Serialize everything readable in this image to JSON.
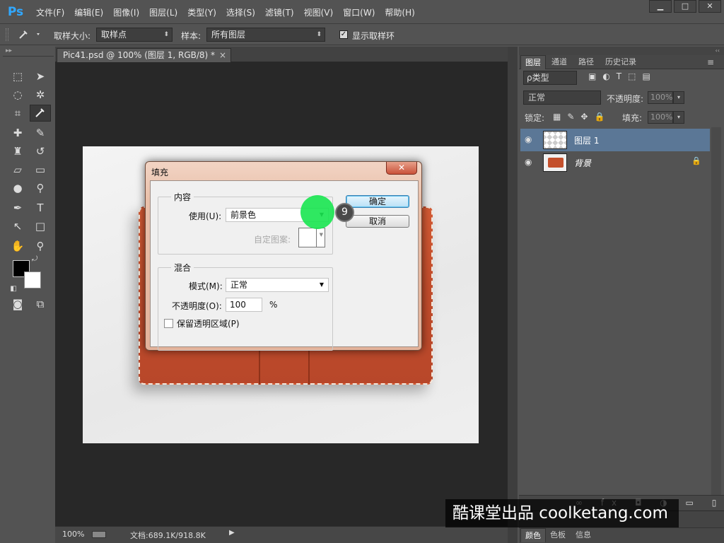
{
  "app": {
    "logo": "Ps",
    "menus": [
      "文件(F)",
      "编辑(E)",
      "图像(I)",
      "图层(L)",
      "类型(Y)",
      "选择(S)",
      "滤镜(T)",
      "视图(V)",
      "窗口(W)",
      "帮助(H)"
    ],
    "window_buttons": [
      "▁",
      "□",
      "✕"
    ]
  },
  "options_bar": {
    "sample_size_label": "取样大小:",
    "sample_size_value": "取样点",
    "sample_label": "样本:",
    "sample_value": "所有图层",
    "show_ring_label": "显示取样环",
    "show_ring_checked": true
  },
  "document": {
    "tab_title": "Pic41.psd @ 100% (图层 1, RGB/8) *",
    "tab_close": "×",
    "zoom": "100%",
    "doc_info": "文档:689.1K/918.8K",
    "status_arrow": "▶"
  },
  "fill_dialog": {
    "title": "填充",
    "close": "✕",
    "contents_group": "内容",
    "use_label": "使用(U):",
    "use_value": "前景色",
    "custom_pattern_label": "自定图案:",
    "blending_group": "混合",
    "mode_label": "模式(M):",
    "mode_value": "正常",
    "opacity_label": "不透明度(O):",
    "opacity_value": "100",
    "opacity_unit": "%",
    "preserve_transparency_label": "保留透明区域(P)",
    "preserve_transparency_checked": false,
    "ok_button": "确定",
    "cancel_button": "取消"
  },
  "tutorial": {
    "step_number": "9"
  },
  "layers_panel": {
    "dock_arrows": "‹‹",
    "tabs": [
      "图层",
      "通道",
      "路径",
      "历史记录"
    ],
    "active_tab": "图层",
    "filter_kind": "ρ类型",
    "blend_mode": "正常",
    "opacity_label": "不透明度:",
    "opacity_value": "100%",
    "lock_label": "锁定:",
    "fill_label": "填充:",
    "fill_value": "100%",
    "layers": [
      {
        "name": "图层 1",
        "selected": true,
        "thumb": "transparent"
      },
      {
        "name": "背景",
        "selected": false,
        "thumb": "wallet",
        "locked": true
      }
    ],
    "footer_icons": "∞ fx ◘ ◑ ▭ ▯ 🗑"
  },
  "bottom_tabs": [
    "颜色",
    "色板",
    "信息"
  ],
  "watermark": "酷课堂出品 coolketang.com",
  "colors": {
    "accent_blue": "#31a8ff",
    "selected_layer": "#5b7796",
    "canvas_bg": "#282828",
    "marker_green": "#18e650"
  }
}
